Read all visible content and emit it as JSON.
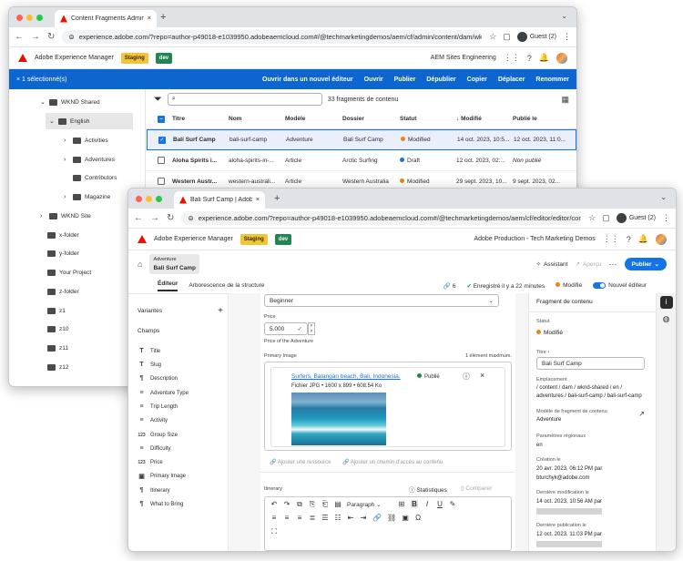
{
  "back_window": {
    "tab_title": "Content Fragments Admin | Ad",
    "url": "experience.adobe.com/?repo=author-p49018-e1039950.adobeaemcloud.com#/@techmarketingdemos/aem/cf/admin/content/dam/wknd-shared/en",
    "guest": "Guest (2)",
    "app_name": "Adobe Experience Manager",
    "badges": [
      "Staging",
      "dev"
    ],
    "org": "AEM Sites Engineering",
    "selected": "× 1 sélectionné(s)",
    "actions": [
      "Ouvrir dans un nouvel éditeur",
      "Ouvrir",
      "Publier",
      "Dépublier",
      "Copier",
      "Déplacer",
      "Renommer"
    ],
    "tree": [
      "WKND Shared",
      "English",
      "Activities",
      "Adventures",
      "Contributors",
      "Magazine",
      "WKND Site",
      "x-folder",
      "y-folder",
      "Your Project",
      "z-folder",
      "z1",
      "z10",
      "z11",
      "z12"
    ],
    "count": "33 fragments de contenu",
    "columns": [
      "Titre",
      "Nom",
      "Modèle",
      "Dossier",
      "Statut",
      "Modifié",
      "Publié le"
    ],
    "rows": [
      {
        "title": "Bali Surf Camp",
        "name": "bali-surf-camp",
        "model": "Adventure",
        "folder": "Bali Surf Camp",
        "status": "Modified",
        "status_color": "#e68619",
        "modified": "14 oct. 2023, 10:5...",
        "published": "12 oct. 2023, 11:0..."
      },
      {
        "title": "Aloha Spirits i...",
        "name": "aloha-spirits-in-...",
        "model": "Article",
        "folder": "Arctic Surfing",
        "status": "Draft",
        "status_color": "#1473e6",
        "modified": "12 oct. 2023, 02:...",
        "published": "Non publié"
      },
      {
        "title": "Western Austr...",
        "name": "western-australi...",
        "model": "Article",
        "folder": "Western Australia",
        "status": "Modified",
        "status_color": "#e68619",
        "modified": "29 sept. 2023, 10...",
        "published": "9 sept. 2023, 02..."
      }
    ]
  },
  "front_window": {
    "tab_title": "Bali Surf Camp | Adobe Experie",
    "url": "experience.adobe.com/?repo=author-p49018-e1039950.adobeaemcloud.com#/@techmarketingdemos/aem/cf/editor/editor/content%2Fdam...",
    "guest": "Guest (2)",
    "app_name": "Adobe Experience Manager",
    "badges": [
      "Staging",
      "dev"
    ],
    "org": "Adobe Production - Tech Marketing Demos",
    "breadcrumb_model": "Adventure",
    "breadcrumb_title": "Bali Surf Camp",
    "assistant": "Assistant",
    "apercu": "Aperçu",
    "publish": "Publier",
    "tabs": [
      "Éditeur",
      "Arborescence de la structure"
    ],
    "link_count": "6",
    "saved": "Enregistré il y a 22 minutes",
    "modified": "Modifié",
    "new_editor": "Nouvel éditeur",
    "variants": "Variantes",
    "fields_title": "Champs",
    "fields": [
      {
        "icon": "T",
        "label": "Title"
      },
      {
        "icon": "T",
        "label": "Slug"
      },
      {
        "icon": "¶",
        "label": "Description"
      },
      {
        "icon": "≡",
        "label": "Adventure Type"
      },
      {
        "icon": "≡",
        "label": "Trip Length"
      },
      {
        "icon": "≡",
        "label": "Activity"
      },
      {
        "icon": "123",
        "label": "Group Size"
      },
      {
        "icon": "≡",
        "label": "Difficulty"
      },
      {
        "icon": "123",
        "label": "Price"
      },
      {
        "icon": "▣",
        "label": "Primary Image"
      },
      {
        "icon": "¶",
        "label": "Itinerary"
      },
      {
        "icon": "¶",
        "label": "What to Bring"
      }
    ],
    "difficulty_value": "Beginner",
    "price_label": "Price",
    "price_value": "5.000",
    "price_help": "Price of the Adventure",
    "image_label": "Primary Image",
    "image_max": "1 élément maximum.",
    "image_title": "Surfers, Balangan beach, Bali, Indonesia.",
    "image_meta": "Fichier JPG • 1600 x 899 • 608.54 Ko",
    "image_status": "Publié",
    "add_resource": "Ajouter une ressource",
    "add_path": "Ajouter un chemin d'accès au contenu",
    "itinerary_label": "Itinerary",
    "stats": "Statistiques",
    "compare": "Comparer",
    "paragraph": "Paragraph",
    "panel_title": "Fragment de contenu",
    "props": {
      "status_label": "Statut",
      "status": "Modifié",
      "title_label": "Titre",
      "title": "Bali Surf Camp",
      "location_label": "Emplacement",
      "location": [
        "/ content / dam / wknd-shared / en /",
        "adventures / bali-surf-camp / bali-surf-camp"
      ],
      "model_label": "Modèle de fragment de contenu",
      "model": "Adventure",
      "region_label": "Paramètres régionaux",
      "region": "en",
      "created_label": "Création le",
      "created": "20 avr. 2023, 06:12 PM par",
      "created_by": "bturchyk@adobe.com",
      "lastmod_label": "Dernière modification le",
      "lastmod": "14 oct. 2023, 10:56 AM par",
      "lastpub_label": "Dernière publication le",
      "lastpub": "12 oct. 2023, 11:03 PM par"
    }
  }
}
